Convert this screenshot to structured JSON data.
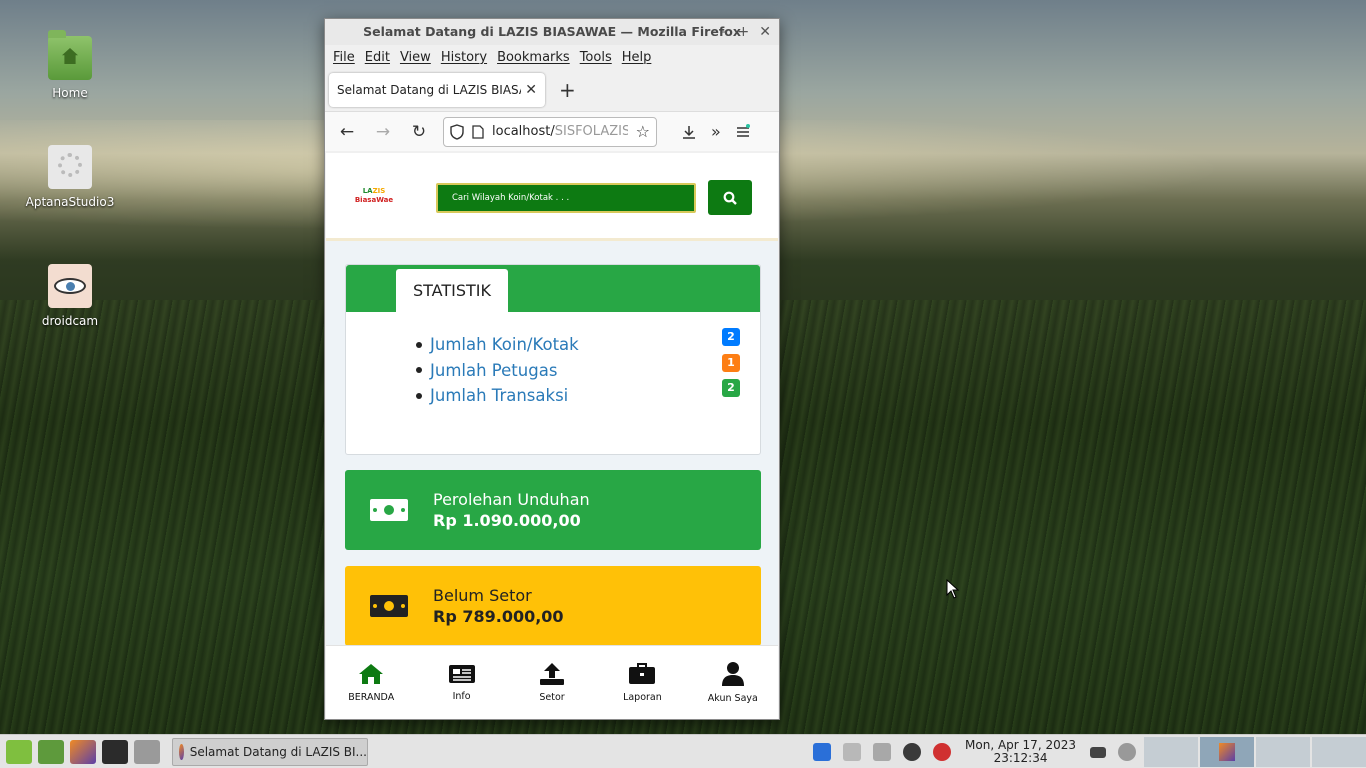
{
  "desktop": {
    "icons": [
      {
        "label": "Home"
      },
      {
        "label": "AptanaStudio3"
      },
      {
        "label": "droidcam"
      }
    ]
  },
  "browser": {
    "window_title": "Selamat Datang di LAZIS BIASAWAE — Mozilla Firefox",
    "menu": [
      "File",
      "Edit",
      "View",
      "History",
      "Bookmarks",
      "Tools",
      "Help"
    ],
    "tab_title": "Selamat Datang di LAZIS BIASAWAE",
    "url_host": "localhost/",
    "url_path": "SISFOLAZIS"
  },
  "site": {
    "logo_top": "LA",
    "logo_accent": "ZIS",
    "logo_bottom": "BiasaWae",
    "search_placeholder": "Cari Wilayah Koin/Kotak . . .",
    "stats_tab": "STATISTIK",
    "stats": [
      {
        "label": "Jumlah Koin/Kotak",
        "count": "2",
        "color": "#007bff"
      },
      {
        "label": "Jumlah Petugas",
        "count": "1",
        "color": "#fd7e14"
      },
      {
        "label": "Jumlah Transaksi",
        "count": "2",
        "color": "#28a745"
      }
    ],
    "income": {
      "label": "Perolehan Unduhan",
      "value": "Rp 1.090.000,00"
    },
    "pending": {
      "label": "Belum Setor",
      "value": "Rp 789.000,00"
    },
    "bottom_nav": [
      "BERANDA",
      "Info",
      "Setor",
      "Laporan",
      "Akun Saya"
    ]
  },
  "taskbar": {
    "task_label": "Selamat Datang di LAZIS BI...",
    "date": "Mon, Apr 17, 2023",
    "time": "23:12:34"
  }
}
